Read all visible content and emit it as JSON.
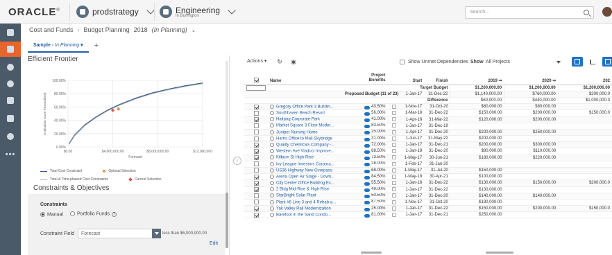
{
  "header": {
    "logo": "ORACLE",
    "workspace": "prodstrategy",
    "context_title": "Engineering",
    "context_sub": "In Burlington",
    "search_placeholder": "Search..."
  },
  "breadcrumb": {
    "parent": "Cost and Funds",
    "page": "Budget Planning",
    "year": "2018",
    "state": "(In Planning)"
  },
  "tabs": [
    {
      "label": "Sample - ",
      "state": "In Planning"
    }
  ],
  "left": {
    "title": "Efficient Frontier",
    "chart_data": {
      "type": "line",
      "title": "",
      "xlabel": "Forecast",
      "ylabel": "Evaluation Score (Normalized)",
      "x_ticks": [
        "$0.00",
        "$4,000,000.00",
        "$8,000,000.00",
        "$12,000,000"
      ],
      "y_ticks": [
        "0.00%",
        "20.00%",
        "40.00%",
        "60.00%",
        "80.00%",
        "100.00%"
      ],
      "xlim": [
        0,
        12000000
      ],
      "ylim": [
        0,
        100
      ],
      "series": [
        {
          "name": "Total Cost Constraint",
          "x": [
            100000,
            600000,
            1500000,
            2500000,
            3500000,
            4500000,
            6000000,
            7500000,
            9000000,
            10500000,
            12000000
          ],
          "y": [
            5,
            18,
            33,
            45,
            55,
            63,
            73,
            81,
            87,
            92,
            96
          ]
        },
        {
          "name": "Total & Time-phased Cost Constraints",
          "x": [
            100000,
            600000,
            1500000,
            2500000,
            3500000,
            4500000,
            6000000,
            7500000,
            9000000,
            10500000,
            12000000
          ],
          "y": [
            4,
            17,
            32,
            44,
            54,
            62,
            72,
            80,
            86,
            91,
            95
          ]
        }
      ],
      "markers": [
        {
          "name": "Optimal Selection",
          "x": 4500000,
          "y": 57
        },
        {
          "name": "Current Selection",
          "x": 4000000,
          "y": 55
        }
      ],
      "legend": [
        "Total Cost Constraint",
        "Optimal Selection",
        "Total & Time-phased Cost Constraints",
        "Current Selection"
      ]
    },
    "constraints_title": "Constraints & Objectives",
    "constraints_label": "Constraints",
    "radio_manual": "Manual",
    "radio_portfolio": "Portfolio Funds",
    "constraint_field_label": "Constraint Field",
    "constraint_field_value": "Forecast",
    "constraint_operator": "less than $6,000,000.00",
    "edit_label": "Edit"
  },
  "toolbar": {
    "actions_label": "Actions",
    "unmet_label": "Show Unmet Dependencies",
    "show_label": "Show",
    "show_value": "All Projects"
  },
  "grid": {
    "headers": [
      "Name",
      "Project Benefits",
      "Start",
      "Finish",
      "2019",
      "2020",
      "202"
    ],
    "summary": [
      {
        "label": "Target Budget",
        "y2019": "$1,200,000.00",
        "y2020": "$1,200,000.00",
        "y2021": "$1,200,000.00"
      },
      {
        "label": "Proposed Budget (11 of 23)",
        "start": "1-Jan-17",
        "finish": "31-Dec-22",
        "y2019": "$1,140,000.00",
        "y2020": "$760,000.00",
        "y2021": "$200,000.0"
      },
      {
        "label": "Difference",
        "y2019": "$60,000.00",
        "y2020": "$440,000.00",
        "y2021": "$1,000,000.0"
      }
    ],
    "rows": [
      {
        "checked": true,
        "name": "Gregory Office Park 3 Buildin...",
        "benefit": "43.50%",
        "start": "1-Nov-17",
        "finish": "31-Oct-20",
        "y2019": "$80,000.00",
        "y2020": "$80,000.00",
        "y2021": ""
      },
      {
        "checked": false,
        "name": "Southhaven Beach Resort",
        "benefit": "56.00%",
        "start": "1-Mar-18",
        "finish": "31-Dec-22",
        "y2019": "$150,000.00",
        "y2020": "$200,000.00",
        "y2021": "$150,000.0"
      },
      {
        "checked": true,
        "name": "Haitang Corporate Park",
        "benefit": "41.00%",
        "start": "1-Apr-18",
        "finish": "31-Mar-22",
        "y2019": "$120,000.00",
        "y2020": "$200,000.00",
        "y2021": ""
      },
      {
        "checked": false,
        "name": "Market Square 3 Floor Moder...",
        "benefit": "83.50%",
        "start": "1-Jan-17",
        "finish": "31-Dec-19",
        "y2019": "",
        "y2020": "",
        "y2021": ""
      },
      {
        "checked": false,
        "name": "Juniper Nursing Home",
        "benefit": "25.00%",
        "start": "1-Apr-17",
        "finish": "31-Dec-20",
        "y2019": "$200,000.00",
        "y2020": "$250,000.00",
        "y2021": ""
      },
      {
        "checked": false,
        "name": "Harris Office to Mall Skybridge",
        "benefit": "31.00%",
        "start": "1-Jun-17",
        "finish": "31-May-22",
        "y2019": "$200,000.00",
        "y2020": "",
        "y2021": ""
      },
      {
        "checked": true,
        "name": "Quality Chemicals Company -...",
        "benefit": "72.00%",
        "start": "1-Jan-17",
        "finish": "31-Dec-21",
        "y2019": "$200,000.00",
        "y2020": "$300,000.00",
        "y2021": ""
      },
      {
        "checked": true,
        "name": "Western Ave Viaduct Improve...",
        "benefit": "88.50%",
        "start": "1-Jan-19",
        "finish": "31-Dec-20",
        "y2019": "$90,000.00",
        "y2020": "$110,000.00",
        "y2021": ""
      },
      {
        "checked": true,
        "name": "Kilburn St High-Rise",
        "benefit": "73.50%",
        "start": "1-May-17",
        "finish": "30-Jun-21",
        "y2019": "$180,000.00",
        "y2020": "$220,000.00",
        "y2021": ""
      },
      {
        "checked": false,
        "name": "Ivy League Investors Corpora...",
        "benefit": "28.00%",
        "start": "1-Feb-17",
        "finish": "31-Jan-20",
        "y2019": "",
        "y2020": "",
        "y2021": ""
      },
      {
        "checked": false,
        "name": "US36 Highway New Overpass",
        "benefit": "68.00%",
        "start": "1-May-17",
        "finish": "31-Jul-20",
        "y2019": "$150,000.00",
        "y2020": "",
        "y2021": ""
      },
      {
        "checked": true,
        "name": "Arena Open Air Stage - Down...",
        "benefit": "84.50%",
        "start": "1-May-18",
        "finish": "30-Apr-21",
        "y2019": "$100,000.00",
        "y2020": "",
        "y2021": ""
      },
      {
        "checked": true,
        "name": "City Center Office Building Ex...",
        "benefit": "55.50%",
        "start": "1-Jan-18",
        "finish": "31-Dec-22",
        "y2019": "$130,000.00",
        "y2020": "$150,000.00",
        "y2021": "$200,000.0"
      },
      {
        "checked": true,
        "name": "2 Bldg Mid-Rise & High-Rise",
        "benefit": "49.00%",
        "start": "1-Jan-17",
        "finish": "31-Dec-22",
        "y2019": "$130,000.00",
        "y2020": "",
        "y2021": ""
      },
      {
        "checked": false,
        "name": "StarBright Solar Plant",
        "benefit": "50.50%",
        "start": "1-Jan-17",
        "finish": "31-Dec-20",
        "y2019": "$140,000.00",
        "y2020": "$140,000.00",
        "y2021": ""
      },
      {
        "checked": false,
        "name": "Plant #6 Line 3 and 4 Rehab a...",
        "benefit": "87.50%",
        "start": "1-Nov-17",
        "finish": "31-Oct-20",
        "y2019": "$190,000.00",
        "y2020": "",
        "y2021": ""
      },
      {
        "checked": true,
        "name": "Yak Valley Rail Modernization",
        "benefit": "25.00%",
        "start": "1-Jan-17",
        "finish": "31-Dec-22",
        "y2019": "$150,000.00",
        "y2020": "$200,000.00",
        "y2021": "$150,000.0"
      },
      {
        "checked": true,
        "name": "Barefoot in the Sand Condo...",
        "benefit": "81.00%",
        "start": "1-Jan-17",
        "finish": "31-Dec-21",
        "y2019": "$250,000.00",
        "y2020": "",
        "y2021": ""
      }
    ]
  },
  "colors": {
    "rail_bg": "#4b5a69",
    "rail_active": "#e8662d",
    "accent_blue": "#1f73c4",
    "curve": "#3e5a82",
    "optimal": "#e8974a",
    "current": "#d9534f"
  }
}
